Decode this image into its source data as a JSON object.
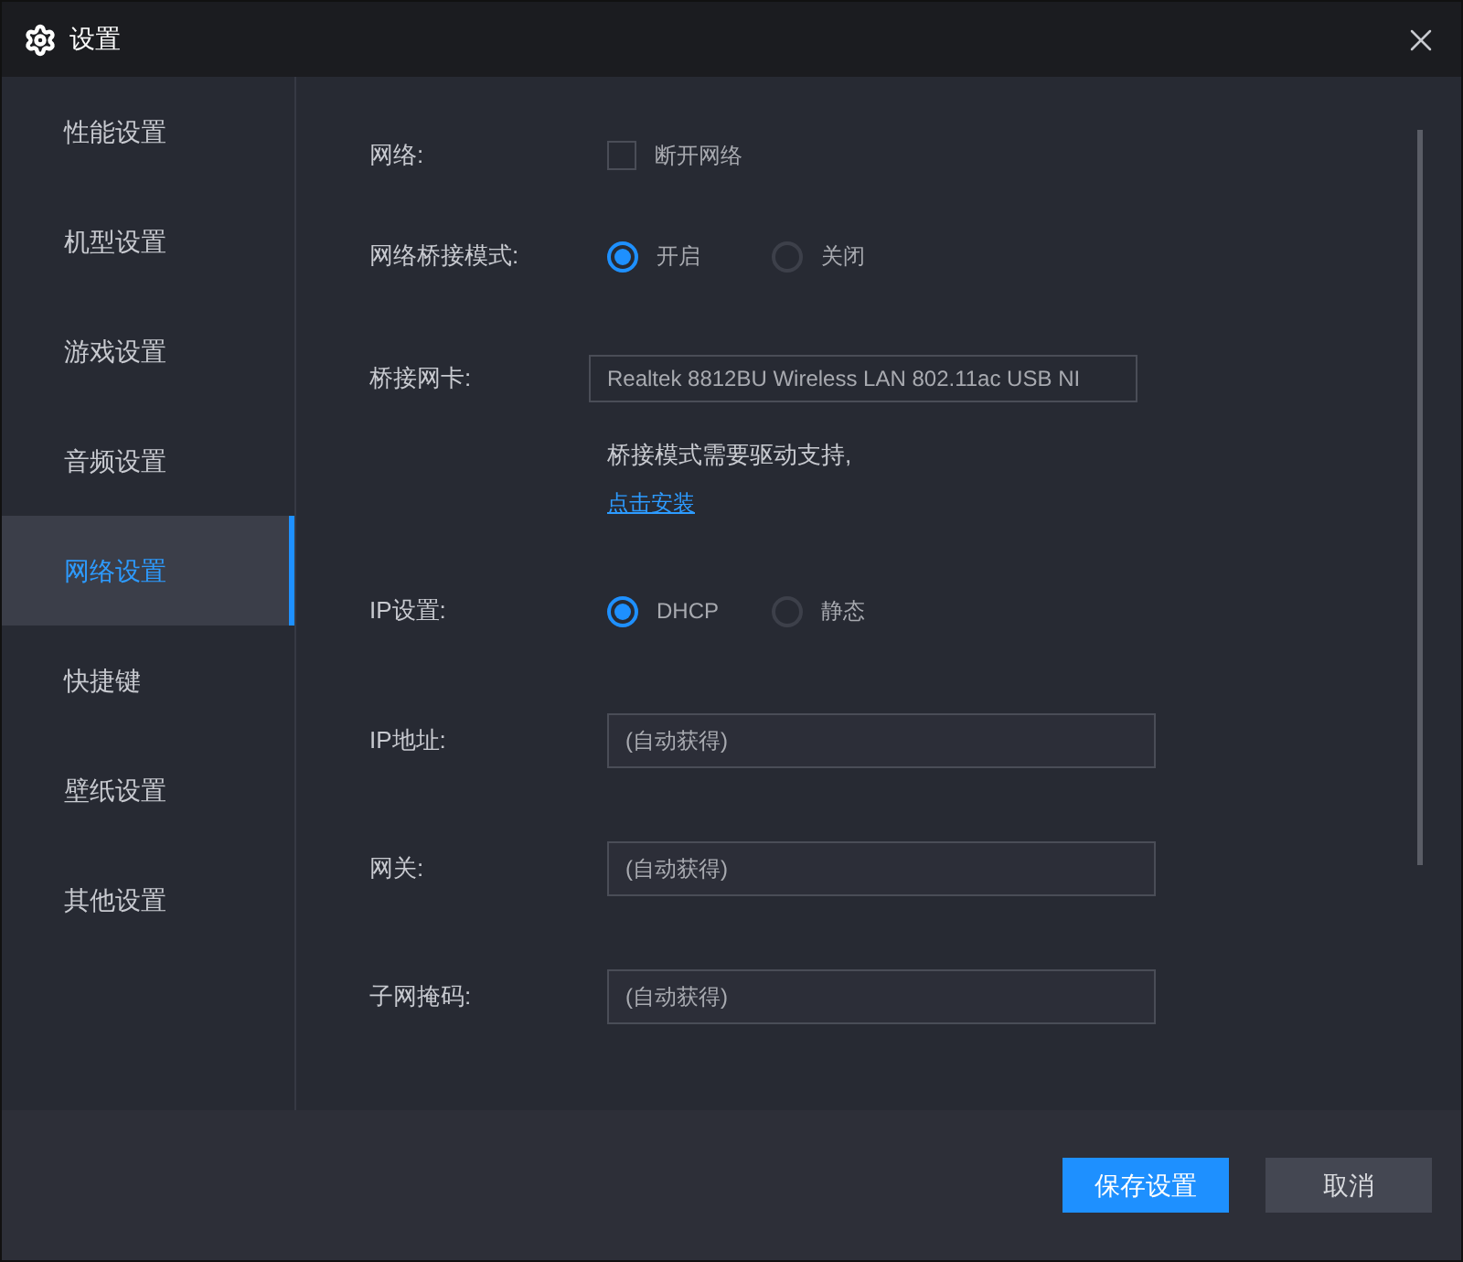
{
  "window": {
    "title": "设置"
  },
  "sidebar": {
    "items": [
      {
        "label": "性能设置",
        "selected": false
      },
      {
        "label": "机型设置",
        "selected": false
      },
      {
        "label": "游戏设置",
        "selected": false
      },
      {
        "label": "音频设置",
        "selected": false
      },
      {
        "label": "网络设置",
        "selected": true
      },
      {
        "label": "快捷键",
        "selected": false
      },
      {
        "label": "壁纸设置",
        "selected": false
      },
      {
        "label": "其他设置",
        "selected": false
      }
    ]
  },
  "form": {
    "rows": [
      {
        "kind": "checkbox",
        "label": "网络:",
        "option": "断开网络",
        "checked": false
      },
      {
        "kind": "radio",
        "label": "网络桥接模式:",
        "options": [
          {
            "label": "开启",
            "selected": true
          },
          {
            "label": "关闭",
            "selected": false
          }
        ]
      },
      {
        "kind": "select",
        "label": "桥接网卡:",
        "value": "Realtek 8812BU Wireless LAN 802.11ac USB NI"
      },
      {
        "kind": "note",
        "text": "桥接模式需要驱动支持,"
      },
      {
        "kind": "link",
        "text": "点击安装"
      },
      {
        "kind": "radio",
        "label": "IP设置:",
        "options": [
          {
            "label": "DHCP",
            "selected": true
          },
          {
            "label": "静态",
            "selected": false
          }
        ]
      },
      {
        "kind": "input",
        "label": "IP地址:",
        "placeholder": "(自动获得)"
      },
      {
        "kind": "input",
        "label": "网关:",
        "placeholder": "(自动获得)"
      },
      {
        "kind": "input",
        "label": "子网掩码:",
        "placeholder": "(自动获得)"
      }
    ]
  },
  "buttons": [
    {
      "label": "保存设置",
      "kind": "primary"
    },
    {
      "label": "取消",
      "kind": "secondary"
    }
  ]
}
